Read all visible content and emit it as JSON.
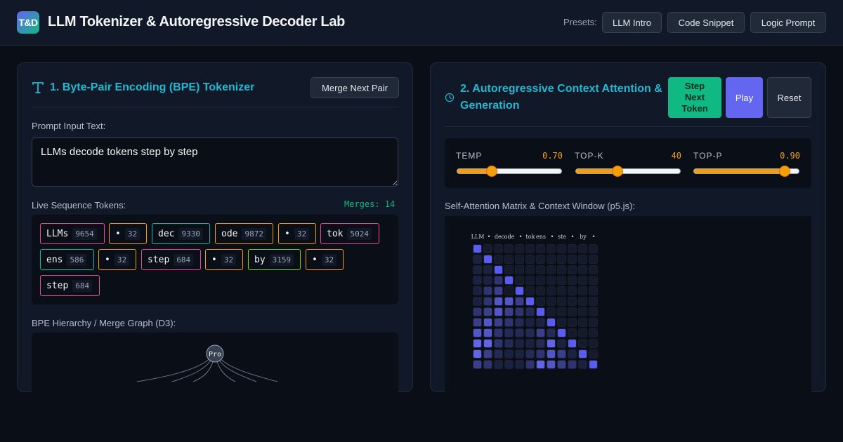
{
  "header": {
    "logo_text": "T&D",
    "title": "LLM Tokenizer & Autoregressive Decoder Lab",
    "presets_label": "Presets:",
    "presets": [
      "LLM Intro",
      "Code Snippet",
      "Logic Prompt"
    ]
  },
  "tokenizer": {
    "title": "1. Byte-Pair Encoding (BPE) Tokenizer",
    "icon": "text-format-icon",
    "merge_button": "Merge Next Pair",
    "input_label": "Prompt Input Text:",
    "input_value": "LLMs decode tokens step by step",
    "tokens_label": "Live Sequence Tokens:",
    "merges_text": "Merges: 14",
    "tokens": [
      {
        "text": "LLMs",
        "id": "9654",
        "color": "#ec4899"
      },
      {
        "text": "•",
        "id": "32",
        "color": "#f59e0b"
      },
      {
        "text": "dec",
        "id": "9330",
        "color": "#14b8a6"
      },
      {
        "text": "ode",
        "id": "9872",
        "color": "#f59e0b"
      },
      {
        "text": "•",
        "id": "32",
        "color": "#f59e0b"
      },
      {
        "text": "tok",
        "id": "5024",
        "color": "#ec4899"
      },
      {
        "text": "ens",
        "id": "586",
        "color": "#14b8a6"
      },
      {
        "text": "•",
        "id": "32",
        "color": "#f59e0b"
      },
      {
        "text": "step",
        "id": "684",
        "color": "#ec4899"
      },
      {
        "text": "•",
        "id": "32",
        "color": "#f59e0b"
      },
      {
        "text": "by",
        "id": "3159",
        "color": "#84cc16"
      },
      {
        "text": "•",
        "id": "32",
        "color": "#f59e0b"
      },
      {
        "text": "step",
        "id": "684",
        "color": "#ec4899"
      }
    ],
    "graph_label": "BPE Hierarchy / Merge Graph (D3):",
    "graph_root": "Pro"
  },
  "decoder": {
    "title_line1": "2. Autoregressive Context Attention &",
    "title_line2": "Generation",
    "icon": "clock-icon",
    "step_button": [
      "Step",
      "Next",
      "Token"
    ],
    "play_button": "Play",
    "reset_button": "Reset",
    "params": [
      {
        "name": "TEMP",
        "value": "0.70",
        "fraction": 0.33
      },
      {
        "name": "TOP-K",
        "value": "40",
        "fraction": 0.4
      },
      {
        "name": "TOP-P",
        "value": "0.90",
        "fraction": 0.86
      }
    ],
    "matrix_label": "Self-Attention Matrix & Context Window (p5.js):",
    "matrix_tokens": [
      "LLM",
      "•",
      "dec",
      "ode",
      "•",
      "tok",
      "ens",
      "•",
      "ste",
      "•",
      "by",
      "•"
    ],
    "matrix_rows": [
      [
        1,
        0,
        0,
        0,
        0,
        0,
        0,
        0,
        0,
        0,
        0,
        0
      ],
      [
        1,
        1,
        0,
        0,
        0,
        0,
        0,
        0,
        0,
        0,
        0,
        0
      ],
      [
        1,
        1,
        1,
        0,
        0,
        0,
        0,
        0,
        0,
        0,
        0,
        0
      ],
      [
        1,
        1,
        3,
        1,
        0,
        0,
        0,
        0,
        0,
        0,
        0,
        0
      ],
      [
        1,
        3,
        4,
        0,
        1,
        0,
        0,
        0,
        0,
        0,
        0,
        0
      ],
      [
        1,
        3,
        5,
        5,
        4,
        1,
        0,
        0,
        0,
        0,
        0,
        0
      ],
      [
        3,
        4,
        5,
        4,
        3,
        2,
        1,
        0,
        0,
        0,
        0,
        0
      ],
      [
        4,
        5,
        4,
        3,
        2,
        1,
        1,
        2,
        0,
        0,
        0,
        0
      ],
      [
        5,
        5,
        3,
        2,
        2,
        2,
        4,
        2,
        0,
        0,
        0,
        0
      ],
      [
        6,
        6,
        3,
        2,
        1,
        1,
        2,
        6,
        1,
        0,
        0,
        0
      ],
      [
        6,
        4,
        2,
        1,
        1,
        2,
        3,
        5,
        4,
        1,
        0,
        0
      ],
      [
        4,
        3,
        1,
        1,
        1,
        3,
        6,
        5,
        4,
        3,
        1,
        1
      ]
    ]
  },
  "colors": {
    "accent_cyan": "#22b8cf",
    "accent_green": "#10b981",
    "accent_indigo": "#6366f1",
    "accent_amber": "#f59e0b"
  }
}
